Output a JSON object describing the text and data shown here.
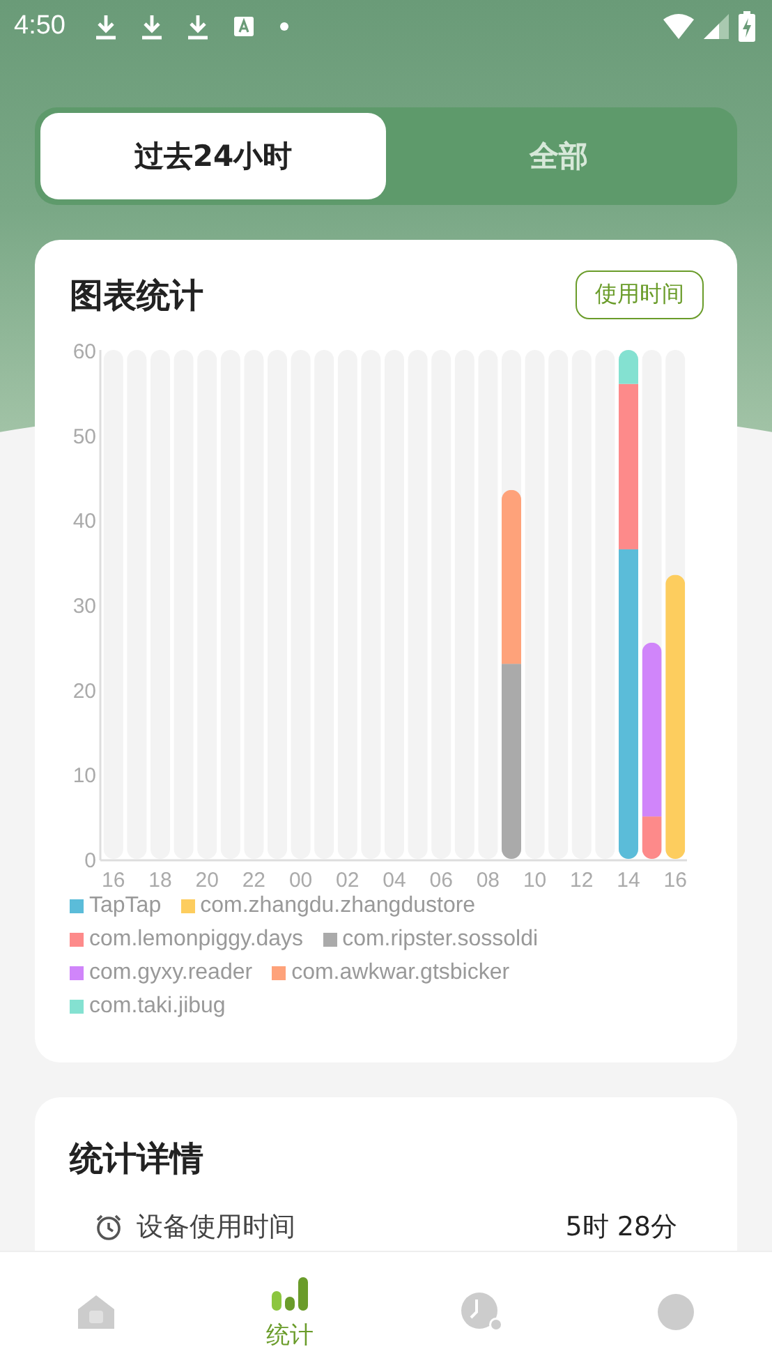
{
  "status_bar": {
    "time": "4:50"
  },
  "range_tabs": [
    {
      "label": "过去24小时",
      "selected": true
    },
    {
      "label": "全部",
      "selected": false
    }
  ],
  "chart_card": {
    "title": "图表统计",
    "mode_button": "使用时间",
    "chart_data": {
      "type": "bar",
      "stacked": true,
      "ylim": [
        0,
        60
      ],
      "yticks": [
        0,
        10,
        20,
        30,
        40,
        50,
        60
      ],
      "categories": [
        "16",
        null,
        "18",
        null,
        "20",
        null,
        "22",
        null,
        "00",
        null,
        "02",
        null,
        "04",
        null,
        "06",
        null,
        "08",
        null,
        "10",
        null,
        "12",
        null,
        "14",
        null,
        "16"
      ],
      "series": [
        {
          "name": "TapTap",
          "color": "#5bbcd9",
          "values": [
            null,
            null,
            null,
            null,
            null,
            null,
            null,
            null,
            null,
            null,
            null,
            null,
            null,
            null,
            null,
            null,
            null,
            null,
            null,
            null,
            null,
            null,
            36.5,
            null,
            null
          ]
        },
        {
          "name": "com.zhangdu.zhangdustore",
          "color": "#fdcd5e",
          "values": [
            null,
            null,
            null,
            null,
            null,
            null,
            null,
            null,
            null,
            null,
            null,
            null,
            null,
            null,
            null,
            null,
            null,
            null,
            null,
            null,
            null,
            null,
            null,
            null,
            33.5
          ]
        },
        {
          "name": "com.lemonpiggy.days",
          "color": "#fd8a8a",
          "values": [
            null,
            null,
            null,
            null,
            null,
            null,
            null,
            null,
            null,
            null,
            null,
            null,
            null,
            null,
            null,
            null,
            null,
            null,
            null,
            null,
            null,
            null,
            19.5,
            5,
            null
          ]
        },
        {
          "name": "com.ripster.sossoldi",
          "color": "#aaaaaa",
          "values": [
            null,
            null,
            null,
            null,
            null,
            null,
            null,
            null,
            null,
            null,
            null,
            null,
            null,
            null,
            null,
            null,
            null,
            23,
            null,
            null,
            null,
            null,
            null,
            null,
            null
          ]
        },
        {
          "name": "com.gyxy.reader",
          "color": "#d085fa",
          "values": [
            null,
            null,
            null,
            null,
            null,
            null,
            null,
            null,
            null,
            null,
            null,
            null,
            null,
            null,
            null,
            null,
            null,
            null,
            null,
            null,
            null,
            null,
            null,
            20.5,
            null
          ]
        },
        {
          "name": "com.awkwar.gtsbicker",
          "color": "#fea27a",
          "values": [
            null,
            null,
            null,
            null,
            null,
            null,
            null,
            null,
            null,
            null,
            null,
            null,
            null,
            null,
            null,
            null,
            null,
            20.5,
            null,
            null,
            null,
            null,
            null,
            null,
            null
          ]
        },
        {
          "name": "com.taki.jibug",
          "color": "#84e1d1",
          "values": [
            null,
            null,
            null,
            null,
            null,
            null,
            null,
            null,
            null,
            null,
            null,
            null,
            null,
            null,
            null,
            null,
            null,
            null,
            null,
            null,
            null,
            null,
            4,
            null,
            null
          ]
        }
      ]
    }
  },
  "details_card": {
    "title": "统计详情",
    "rows": [
      {
        "label": "设备使用时间",
        "value": "5时 28分"
      }
    ]
  },
  "bottom_nav": [
    {
      "kind": "home",
      "selected": false
    },
    {
      "kind": "stats",
      "label": "统计",
      "selected": true
    },
    {
      "kind": "history",
      "selected": false
    },
    {
      "kind": "profile",
      "selected": false
    }
  ]
}
